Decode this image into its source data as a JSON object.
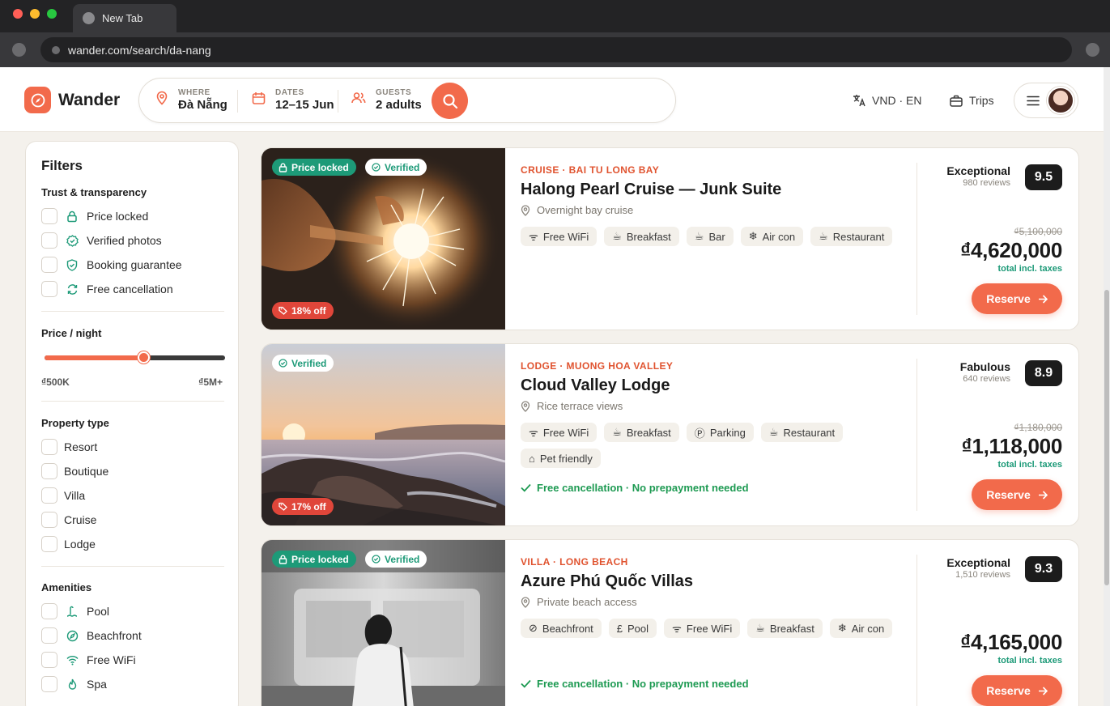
{
  "browser": {
    "tab_title": "New Tab",
    "url": "wander.com/search/da-nang",
    "traffic_lights": [
      "#ff5f57",
      "#febc2e",
      "#28c840"
    ]
  },
  "header": {
    "brand": "Wander",
    "accent_color": "#f26a4b",
    "search": {
      "where_label": "WHERE",
      "where_value": "Đà Nẵng",
      "dates_label": "DATES",
      "dates_value": "12–15 Jun",
      "guests_label": "GUESTS",
      "guests_value": "2 adults"
    },
    "currency_language": "VND · EN",
    "trips": "Trips"
  },
  "filters": {
    "title": "Filters",
    "trust": {
      "title": "Trust & transparency",
      "items": [
        {
          "label": "Price locked",
          "icon": "lock-icon"
        },
        {
          "label": "Verified photos",
          "icon": "verified-icon"
        },
        {
          "label": "Booking guarantee",
          "icon": "shield-icon"
        },
        {
          "label": "Free cancellation",
          "icon": "refresh-icon"
        }
      ]
    },
    "price": {
      "title": "Price / night",
      "min_label": "₫500K",
      "max_label": "₫5M+",
      "selected_fraction": 0.55
    },
    "property_type": {
      "title": "Property type",
      "items": [
        "Resort",
        "Boutique",
        "Villa",
        "Cruise",
        "Lodge"
      ]
    },
    "amenities": {
      "title": "Amenities",
      "items": [
        {
          "label": "Pool",
          "icon": "pool-icon"
        },
        {
          "label": "Beachfront",
          "icon": "compass-icon"
        },
        {
          "label": "Free WiFi",
          "icon": "wifi-icon"
        },
        {
          "label": "Spa",
          "icon": "flame-icon"
        }
      ]
    }
  },
  "results": [
    {
      "category": "CRUISE · BAI TU LONG BAY",
      "name": "Halong Pearl Cruise — Junk Suite",
      "subtitle": "Overnight bay cruise",
      "badges": {
        "price_locked": "Price locked",
        "verified": "Verified",
        "discount": "18% off"
      },
      "amenities": [
        "Free WiFi",
        "Breakfast",
        "Bar",
        "Air con",
        "Restaurant"
      ],
      "rating_label": "Exceptional",
      "reviews": "980 reviews",
      "score": "9.5",
      "old_price": "₫5,100,000",
      "price": "₫4,620,000",
      "tax_note": "total incl. taxes",
      "reserve": "Reserve"
    },
    {
      "category": "LODGE · MUONG HOA VALLEY",
      "name": "Cloud Valley Lodge",
      "subtitle": "Rice terrace views",
      "badges": {
        "verified": "Verified",
        "discount": "17% off"
      },
      "amenities": [
        "Free WiFi",
        "Breakfast",
        "Parking",
        "Restaurant",
        "Pet friendly"
      ],
      "free_cancel": "Free cancellation · No prepayment needed",
      "rating_label": "Fabulous",
      "reviews": "640 reviews",
      "score": "8.9",
      "old_price": "₫1,180,000",
      "price": "₫1,118,000",
      "tax_note": "total incl. taxes",
      "reserve": "Reserve"
    },
    {
      "category": "VILLA · LONG BEACH",
      "name": "Azure Phú Quốc Villas",
      "subtitle": "Private beach access",
      "badges": {
        "price_locked": "Price locked",
        "verified": "Verified"
      },
      "amenities": [
        "Beachfront",
        "Pool",
        "Free WiFi",
        "Breakfast",
        "Air con"
      ],
      "free_cancel": "Free cancellation · No prepayment needed",
      "rating_label": "Exceptional",
      "reviews": "1,510 reviews",
      "score": "9.3",
      "price": "₫4,165,000",
      "tax_note": "total incl. taxes",
      "reserve": "Reserve"
    }
  ]
}
